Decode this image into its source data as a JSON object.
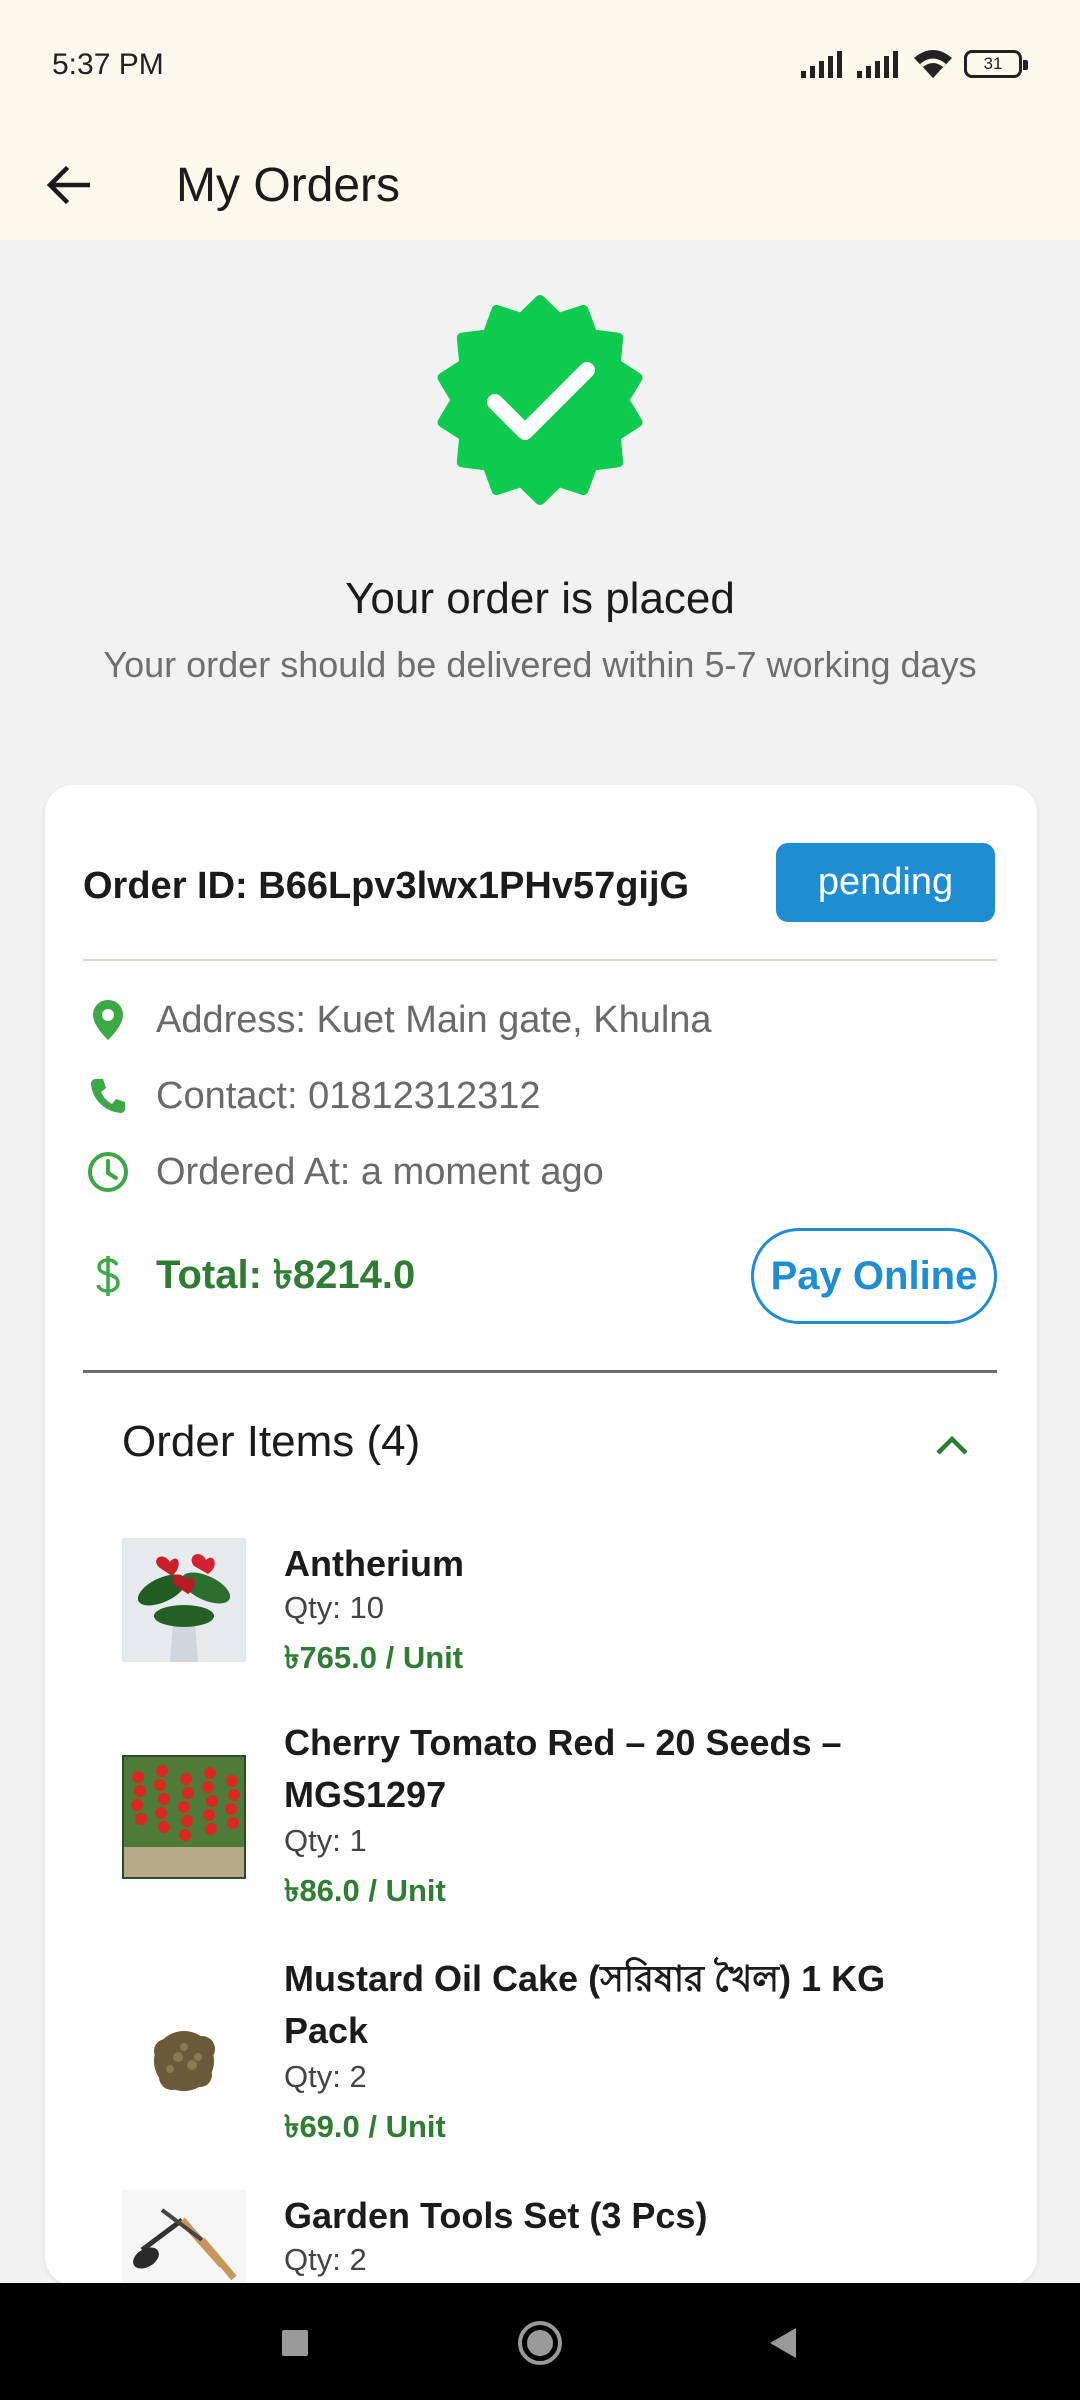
{
  "status_bar": {
    "time": "5:37 PM",
    "battery": "31"
  },
  "app_bar": {
    "title": "My Orders",
    "back_icon": "arrow-left-icon"
  },
  "hero": {
    "icon": "verified-check-badge-icon",
    "badge_color": "#0ecb4f",
    "title": "Your order is placed",
    "subtitle": "Your order should be delivered within 5-7 working days"
  },
  "order": {
    "id_label": "Order ID: B66Lpv3lwx1PHv57gijG",
    "status": "pending",
    "status_color": "#1e8dd2",
    "address": "Address: Kuet Main gate, Khulna",
    "contact": "Contact: 01812312312",
    "ordered_at": "Ordered At: a moment ago",
    "total": "Total: ৳8214.0",
    "pay_label": "Pay Online",
    "accent_green": "#2f7d32"
  },
  "items_section": {
    "title": "Order Items (4)",
    "toggle_icon": "chevron-up-icon",
    "items": [
      {
        "name": "Antherium",
        "qty": "Qty: 10",
        "price": "৳765.0 / Unit"
      },
      {
        "name": "Cherry Tomato Red – 20 Seeds – MGS1297",
        "qty": "Qty: 1",
        "price": "৳86.0 / Unit"
      },
      {
        "name": "Mustard Oil Cake (সরিষার খৈল) 1 KG Pack",
        "qty": "Qty: 2",
        "price": "৳69.0 / Unit"
      },
      {
        "name": "Garden Tools Set (3 Pcs)",
        "qty": "Qty: 2",
        "price": ""
      }
    ]
  },
  "nav_bar": {
    "recents_icon": "square-icon",
    "home_icon": "circle-home-icon",
    "back_icon": "triangle-back-icon"
  }
}
